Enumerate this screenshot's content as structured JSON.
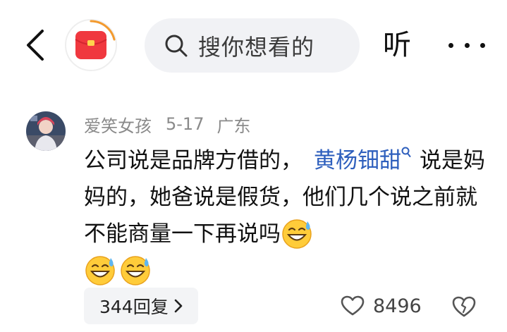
{
  "topbar": {
    "back_icon": "chevron-left-icon",
    "redpacket_icon": "red-packet-icon",
    "search_placeholder": "搜你想看的",
    "listen_label": "听",
    "more_icon": "more-horizontal-icon"
  },
  "comment": {
    "username": "爱笑女孩",
    "date": "5-17",
    "location": "广东",
    "text_part1": "公司说是品牌方借的，",
    "mention": "黄杨钿甜",
    "text_part2": "说是妈妈的，她爸说是假货，他们几个说之前就不能商量一下再说吗",
    "emoji_icon": "grinning-sweat-emoji"
  },
  "actions": {
    "reply_label": "344回复",
    "like_count": "8496",
    "like_icon": "heart-outline-icon",
    "dislike_icon": "broken-heart-icon"
  },
  "colors": {
    "mention": "#2e5fbd",
    "meta_text": "#8a8a8a",
    "redpacket": "#f0383f",
    "search_bg": "#f1f2f5"
  }
}
